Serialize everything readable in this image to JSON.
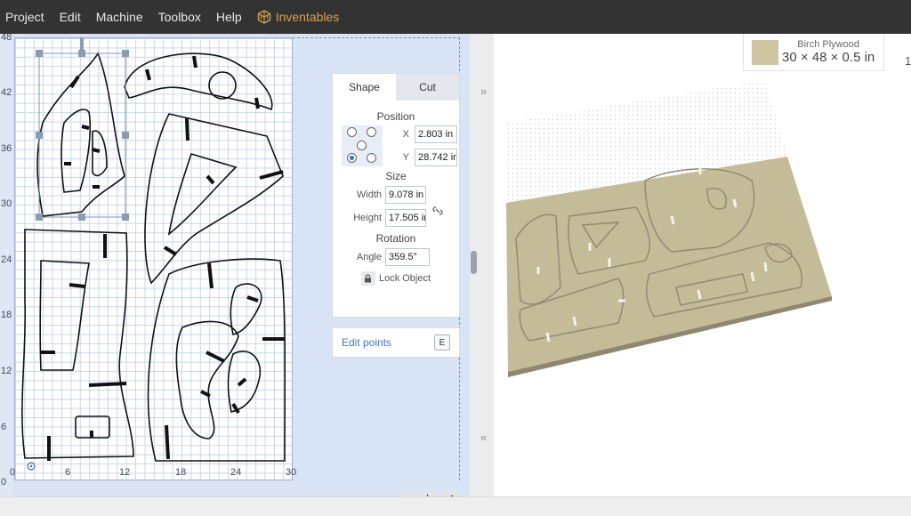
{
  "menubar": {
    "items": [
      "Project",
      "Edit",
      "Machine",
      "Toolbox",
      "Help"
    ],
    "brand": "Inventables",
    "brand_color": "#d9a24a"
  },
  "ruler": {
    "y_labels": [
      "48",
      "42",
      "36",
      "30",
      "24",
      "18",
      "12",
      "6",
      "0"
    ],
    "x_labels": [
      "0",
      "6",
      "12",
      "18",
      "24",
      "30"
    ]
  },
  "panel": {
    "tabs": [
      "Shape",
      "Cut"
    ],
    "active_tab": "Shape",
    "position_title": "Position",
    "x_label": "X",
    "x_value": "2.803 in",
    "y_label": "Y",
    "y_value": "28.742 in",
    "size_title": "Size",
    "width_label": "Width",
    "width_value": "9.078 in",
    "height_label": "Height",
    "height_value": "17.505 in",
    "rotation_title": "Rotation",
    "angle_label": "Angle",
    "angle_value": "359.5°",
    "lock_label": "Lock Object"
  },
  "edit_points": {
    "label": "Edit points",
    "shortcut": "E"
  },
  "zoom": {
    "minus": "−",
    "plus": "+"
  },
  "material": {
    "name": "Birch Plywood",
    "dims": "30 × 48 × 0.5 in",
    "swatch_color": "#cfc4a0",
    "edge_label": "1"
  },
  "icons": {
    "brand": "inventables-cube-icon",
    "collapse_right": "chevron-double-right-icon",
    "collapse_left": "chevron-double-left-icon",
    "home": "home-icon",
    "lock": "lock-icon",
    "link": "link-aspect-icon"
  }
}
